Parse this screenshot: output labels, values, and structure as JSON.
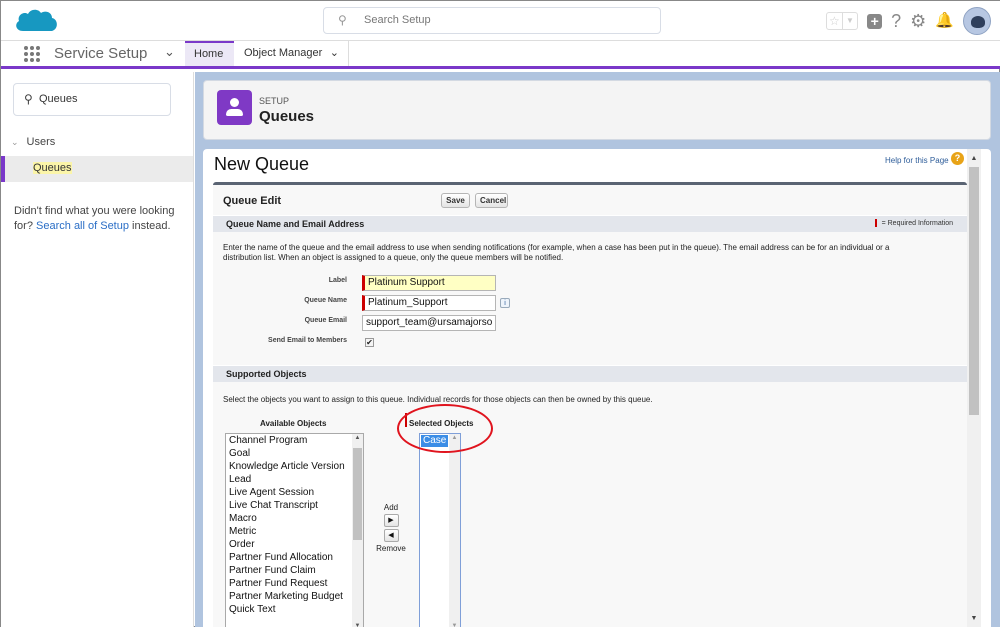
{
  "header": {
    "search_placeholder": "Search Setup",
    "icons": [
      "favorites-star-icon",
      "add-icon",
      "help-icon",
      "gear-icon",
      "bell-icon",
      "avatar"
    ]
  },
  "nav": {
    "app_name": "Service Setup",
    "tabs": [
      {
        "label": "Home",
        "active": true
      },
      {
        "label": "Object Manager",
        "active": false
      }
    ]
  },
  "sidebar": {
    "quickfind_value": "Queues",
    "tree": [
      {
        "label": "Users",
        "expanded": true
      },
      {
        "label": "Queues",
        "selected": true
      }
    ],
    "not_found_text": "Didn't find what you were looking for?",
    "search_all_link": "Search all of Setup",
    "instead_text": "instead."
  },
  "setup_header": {
    "kicker": "SETUP",
    "title": "Queues"
  },
  "page": {
    "title": "New Queue",
    "help_link": "Help for this Page",
    "block_title": "Queue Edit",
    "save_label": "Save",
    "cancel_label": "Cancel",
    "section1_title": "Queue Name and Email Address",
    "required_legend": "= Required Information",
    "section1_desc_line1": "Enter the name of the queue and the email address to use when sending notifications (for example, when a case has been put in the queue). The email address can be for an individual or a",
    "section1_desc_line2": "distribution list. When an object is assigned to a queue, only the queue members will be notified.",
    "fields": {
      "label_label": "Label",
      "label_value": "Platinum Support",
      "queue_name_label": "Queue Name",
      "queue_name_value": "Platinum_Support",
      "queue_email_label": "Queue Email",
      "queue_email_value": "support_team@ursamajorso",
      "send_email_label": "Send Email to Members",
      "send_email_checked": true
    },
    "section2_title": "Supported Objects",
    "section2_desc": "Select the objects you want to assign to this queue. Individual records for those objects can then be owned by this queue.",
    "available_label": "Available Objects",
    "selected_label": "Selected Objects",
    "add_label": "Add",
    "remove_label": "Remove",
    "available_objects": [
      "Channel Program",
      "Goal",
      "Knowledge Article Version",
      "Lead",
      "Live Agent Session",
      "Live Chat Transcript",
      "Macro",
      "Metric",
      "Order",
      "Partner Fund Allocation",
      "Partner Fund Claim",
      "Partner Fund Request",
      "Partner Marketing Budget",
      "Quick Text"
    ],
    "selected_objects": [
      "Case"
    ]
  },
  "colors": {
    "accent_purple": "#7a38c9",
    "required_red": "#cc0000",
    "annotation_red": "#e0141e",
    "selection_blue": "#3b8de6",
    "highlight_yellow": "#ffffc4"
  }
}
